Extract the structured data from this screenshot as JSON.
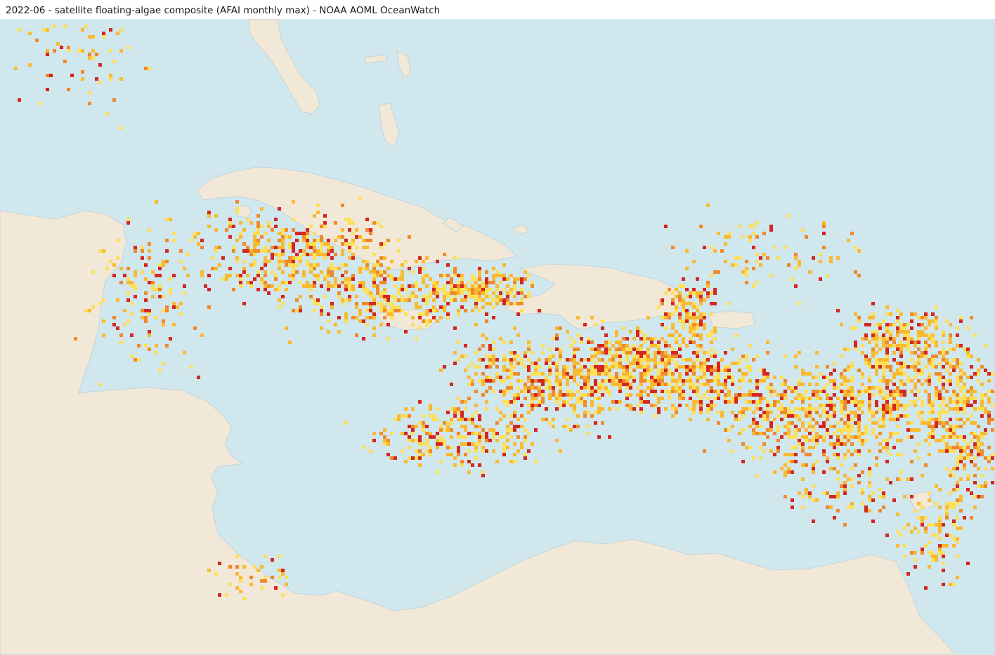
{
  "title": "2022-06 - satellite floating-algae composite (AFAI monthly max) - NOAA AOML OceanWatch",
  "colors": {
    "ocean": "#d0e7ee",
    "land": "#f1e8d8",
    "coast": "#c2d4d9",
    "density_low": "#fde05a",
    "density_mid": "#f9ba30",
    "density_high": "#ef8a2c",
    "density_max": "#d5261f"
  },
  "layers": [
    "ocean",
    "land",
    "sargassum-density-cells"
  ]
}
